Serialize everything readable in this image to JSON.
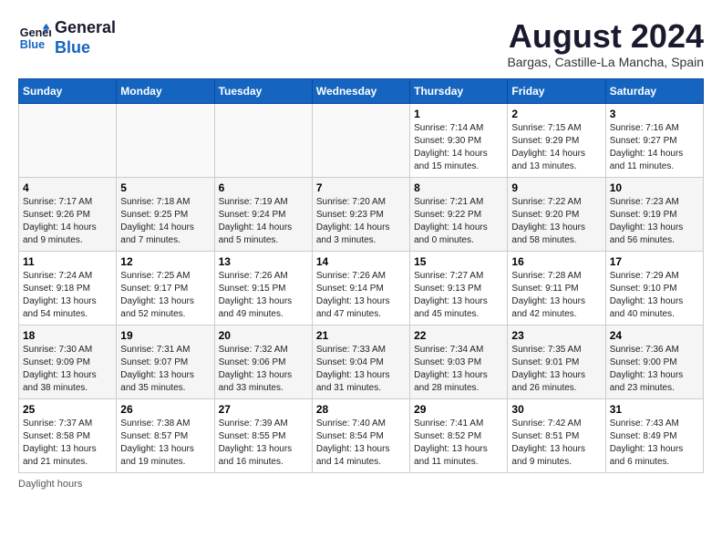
{
  "header": {
    "logo_line1": "General",
    "logo_line2": "Blue",
    "month_title": "August 2024",
    "subtitle": "Bargas, Castille-La Mancha, Spain"
  },
  "days_of_week": [
    "Sunday",
    "Monday",
    "Tuesday",
    "Wednesday",
    "Thursday",
    "Friday",
    "Saturday"
  ],
  "footer": {
    "note": "Daylight hours"
  },
  "weeks": [
    [
      {
        "day": "",
        "info": ""
      },
      {
        "day": "",
        "info": ""
      },
      {
        "day": "",
        "info": ""
      },
      {
        "day": "",
        "info": ""
      },
      {
        "day": "1",
        "info": "Sunrise: 7:14 AM\nSunset: 9:30 PM\nDaylight: 14 hours\nand 15 minutes."
      },
      {
        "day": "2",
        "info": "Sunrise: 7:15 AM\nSunset: 9:29 PM\nDaylight: 14 hours\nand 13 minutes."
      },
      {
        "day": "3",
        "info": "Sunrise: 7:16 AM\nSunset: 9:27 PM\nDaylight: 14 hours\nand 11 minutes."
      }
    ],
    [
      {
        "day": "4",
        "info": "Sunrise: 7:17 AM\nSunset: 9:26 PM\nDaylight: 14 hours\nand 9 minutes."
      },
      {
        "day": "5",
        "info": "Sunrise: 7:18 AM\nSunset: 9:25 PM\nDaylight: 14 hours\nand 7 minutes."
      },
      {
        "day": "6",
        "info": "Sunrise: 7:19 AM\nSunset: 9:24 PM\nDaylight: 14 hours\nand 5 minutes."
      },
      {
        "day": "7",
        "info": "Sunrise: 7:20 AM\nSunset: 9:23 PM\nDaylight: 14 hours\nand 3 minutes."
      },
      {
        "day": "8",
        "info": "Sunrise: 7:21 AM\nSunset: 9:22 PM\nDaylight: 14 hours\nand 0 minutes."
      },
      {
        "day": "9",
        "info": "Sunrise: 7:22 AM\nSunset: 9:20 PM\nDaylight: 13 hours\nand 58 minutes."
      },
      {
        "day": "10",
        "info": "Sunrise: 7:23 AM\nSunset: 9:19 PM\nDaylight: 13 hours\nand 56 minutes."
      }
    ],
    [
      {
        "day": "11",
        "info": "Sunrise: 7:24 AM\nSunset: 9:18 PM\nDaylight: 13 hours\nand 54 minutes."
      },
      {
        "day": "12",
        "info": "Sunrise: 7:25 AM\nSunset: 9:17 PM\nDaylight: 13 hours\nand 52 minutes."
      },
      {
        "day": "13",
        "info": "Sunrise: 7:26 AM\nSunset: 9:15 PM\nDaylight: 13 hours\nand 49 minutes."
      },
      {
        "day": "14",
        "info": "Sunrise: 7:26 AM\nSunset: 9:14 PM\nDaylight: 13 hours\nand 47 minutes."
      },
      {
        "day": "15",
        "info": "Sunrise: 7:27 AM\nSunset: 9:13 PM\nDaylight: 13 hours\nand 45 minutes."
      },
      {
        "day": "16",
        "info": "Sunrise: 7:28 AM\nSunset: 9:11 PM\nDaylight: 13 hours\nand 42 minutes."
      },
      {
        "day": "17",
        "info": "Sunrise: 7:29 AM\nSunset: 9:10 PM\nDaylight: 13 hours\nand 40 minutes."
      }
    ],
    [
      {
        "day": "18",
        "info": "Sunrise: 7:30 AM\nSunset: 9:09 PM\nDaylight: 13 hours\nand 38 minutes."
      },
      {
        "day": "19",
        "info": "Sunrise: 7:31 AM\nSunset: 9:07 PM\nDaylight: 13 hours\nand 35 minutes."
      },
      {
        "day": "20",
        "info": "Sunrise: 7:32 AM\nSunset: 9:06 PM\nDaylight: 13 hours\nand 33 minutes."
      },
      {
        "day": "21",
        "info": "Sunrise: 7:33 AM\nSunset: 9:04 PM\nDaylight: 13 hours\nand 31 minutes."
      },
      {
        "day": "22",
        "info": "Sunrise: 7:34 AM\nSunset: 9:03 PM\nDaylight: 13 hours\nand 28 minutes."
      },
      {
        "day": "23",
        "info": "Sunrise: 7:35 AM\nSunset: 9:01 PM\nDaylight: 13 hours\nand 26 minutes."
      },
      {
        "day": "24",
        "info": "Sunrise: 7:36 AM\nSunset: 9:00 PM\nDaylight: 13 hours\nand 23 minutes."
      }
    ],
    [
      {
        "day": "25",
        "info": "Sunrise: 7:37 AM\nSunset: 8:58 PM\nDaylight: 13 hours\nand 21 minutes."
      },
      {
        "day": "26",
        "info": "Sunrise: 7:38 AM\nSunset: 8:57 PM\nDaylight: 13 hours\nand 19 minutes."
      },
      {
        "day": "27",
        "info": "Sunrise: 7:39 AM\nSunset: 8:55 PM\nDaylight: 13 hours\nand 16 minutes."
      },
      {
        "day": "28",
        "info": "Sunrise: 7:40 AM\nSunset: 8:54 PM\nDaylight: 13 hours\nand 14 minutes."
      },
      {
        "day": "29",
        "info": "Sunrise: 7:41 AM\nSunset: 8:52 PM\nDaylight: 13 hours\nand 11 minutes."
      },
      {
        "day": "30",
        "info": "Sunrise: 7:42 AM\nSunset: 8:51 PM\nDaylight: 13 hours\nand 9 minutes."
      },
      {
        "day": "31",
        "info": "Sunrise: 7:43 AM\nSunset: 8:49 PM\nDaylight: 13 hours\nand 6 minutes."
      }
    ]
  ]
}
